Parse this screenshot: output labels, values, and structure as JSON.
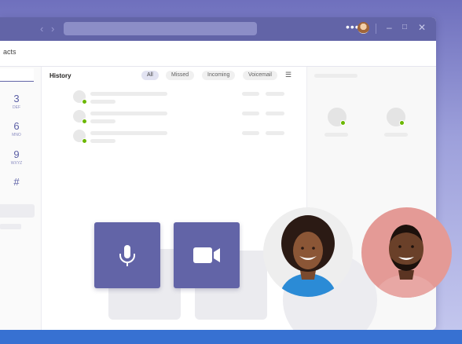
{
  "titlebar": {
    "more_label": "•••",
    "minimize_label": "–",
    "maximize_label": "□",
    "close_label": "✕",
    "back_label": "‹",
    "forward_label": "›"
  },
  "subheader": {
    "tab_label": "acts"
  },
  "dialpad": {
    "keys": [
      {
        "number": "3",
        "letters": "DEF"
      },
      {
        "number": "6",
        "letters": "MNO"
      },
      {
        "number": "9",
        "letters": "WXYZ"
      },
      {
        "number": "#",
        "letters": ""
      }
    ]
  },
  "history": {
    "title": "History",
    "filters": [
      "All",
      "Missed",
      "Incoming",
      "Voicemail"
    ],
    "active_filter": "All"
  },
  "call_controls": {
    "mic_icon": "microphone-icon",
    "video_icon": "video-camera-icon"
  },
  "colors": {
    "brand": "#6264a7",
    "presence": "#6bb700",
    "bottom_bar": "#3771d2"
  }
}
